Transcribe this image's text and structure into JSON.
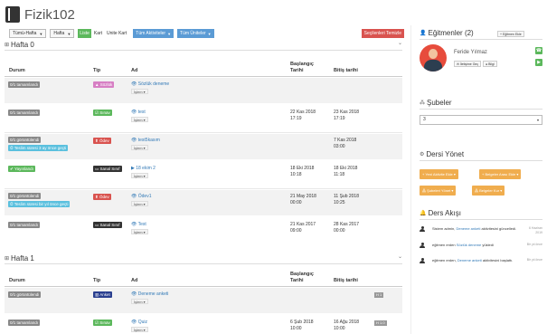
{
  "app": {
    "title": "Fizik102"
  },
  "toolbar": {
    "week_filter": "Tümü-Hafta",
    "period": "Hafta",
    "view_list": "Liste",
    "view_card": "Kart",
    "view_unit_card": "Unite Kart",
    "all_activities": "Tüm Aktiviteler",
    "all_units": "Tüm Üniteler",
    "delete_selected": "Seçilenleri Temizle"
  },
  "columns": {
    "status": "Durum",
    "type": "Tip",
    "name": "Ad",
    "start_1": "Başlangıç",
    "start_2": "Tarihi",
    "end": "Bitiş tarihi"
  },
  "week0": {
    "title": "Hafta 0",
    "rows": [
      {
        "status": "0/1 tamamlandı",
        "type": "Sözlük",
        "name": "Sözlük deneme",
        "action": "İşlem",
        "start_1": "",
        "start_2": "",
        "end_1": "",
        "end_2": ""
      },
      {
        "status": "0/1 tamamlandı",
        "type": "Sınav",
        "name": "test",
        "action": "İşlem",
        "start_1": "22 Kas 2018",
        "start_2": "17:19",
        "end_1": "23 Kas 2018",
        "end_2": "17:19"
      },
      {
        "status": "0/1 görüntülendi",
        "status2": "Teslim süresi 3 ay önce geçti",
        "type": "Ödev",
        "name": "test5kasım",
        "action": "İşlem",
        "start_1": "",
        "start_2": "",
        "end_1": "7 Kas 2018",
        "end_2": "03:00"
      },
      {
        "status": "Yayınlandı",
        "type": "Sanal Sınıf",
        "name": "18 ekim 2",
        "action": "İşlem",
        "start_1": "18 Eki 2018",
        "start_2": "10:18",
        "end_1": "18 Eki 2018",
        "end_2": "11:18"
      },
      {
        "status": "0/1 görüntülendi",
        "status2": "Teslim süresi bir yıl önce geçti",
        "type": "Ödev",
        "name": "Ödev1",
        "action": "İşlem",
        "start_1": "21 May 2018",
        "start_2": "00:00",
        "end_1": "11 Şub 2018",
        "end_2": "10:25"
      },
      {
        "status": "0/1 tamamlandı",
        "type": "Sanal Sınıf",
        "name": "Test",
        "action": "İşlem",
        "start_1": "21 Kas 2017",
        "start_2": "09:00",
        "end_1": "28 Kas 2017",
        "end_2": "00:00"
      }
    ]
  },
  "week1": {
    "title": "Hafta 1",
    "rows": [
      {
        "status": "0/1 görüntülendi",
        "type": "Anket",
        "name": "Deneme anketi",
        "action": "İşlem",
        "start_1": "",
        "start_2": "",
        "end_1": "",
        "end_2": "",
        "badge": "H 1"
      },
      {
        "status": "0/1 tamamlandı",
        "type": "Sınav",
        "name": "Quiz",
        "action": "İşlem",
        "start_1": "6 Şub 2018",
        "start_2": "10:00",
        "end_1": "16 Ağu 2018",
        "end_2": "10:00",
        "badge": "H 1.0"
      }
    ]
  },
  "instructors": {
    "title": "Eğitmenler (2)",
    "add_button": "Eğitmen Ekle",
    "name": "Feride Yılmaz",
    "message_btn": "İletişime Geç",
    "info_btn": "Bilgi"
  },
  "branches": {
    "title": "Şubeler",
    "selected": "3"
  },
  "manage": {
    "title": "Dersi Yönet",
    "btn_add_activity": "Yeni Aktivite Ekle",
    "btn_add_unit": "Belgeler Arası Ekle",
    "btn_branches": "Şubeleri Yönet",
    "btn_documents": "Belgeler Kur"
  },
  "feed": {
    "title": "Ders Akışı",
    "items": [
      {
        "pre": "Sistem admin, ",
        "link": "Deneme anketi",
        "post": " aktivitesini güncelledi.",
        "time": "6 Haziran 2019"
      },
      {
        "pre": "eğitmen erden ",
        "link": "Sözlük deneme",
        "post": " yükledi",
        "time": "Bir yıl önce"
      },
      {
        "pre": "eğitmen erden, ",
        "link": "Deneme anketi",
        "post": " aktivitesini başlattı.",
        "time": "Bir yıl önce"
      }
    ]
  },
  "colors": {
    "green": "#5cb85c",
    "red": "#d9534f",
    "blue": "#5b9bd5",
    "orange": "#f0ad4e",
    "info": "#5bc0de"
  }
}
